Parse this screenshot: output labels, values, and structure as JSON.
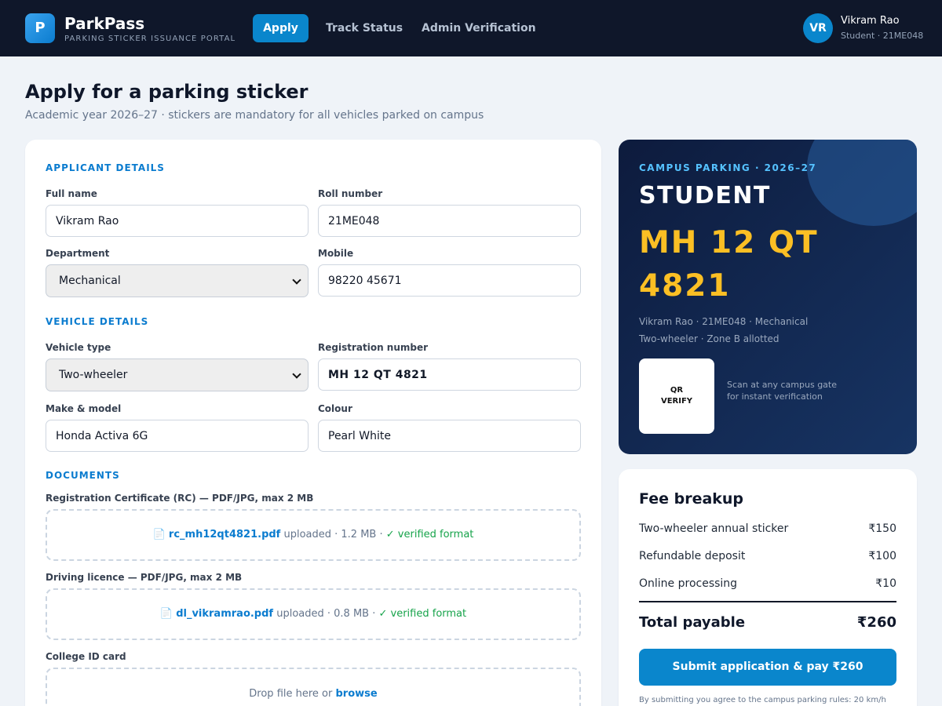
{
  "header": {
    "logo_letter": "P",
    "brand": "ParkPass",
    "brand_sub": "PARKING STICKER ISSUANCE PORTAL",
    "nav": [
      "Apply",
      "Track Status",
      "Admin Verification"
    ],
    "user": {
      "initials": "VR",
      "name": "Vikram Rao",
      "sub": "Student · 21ME048"
    }
  },
  "page": {
    "title": "Apply for a parking sticker",
    "subtitle": "Academic year 2026–27 · stickers are mandatory for all vehicles parked on campus"
  },
  "form": {
    "applicant_title": "APPLICANT DETAILS",
    "full_name_label": "Full name",
    "full_name": "Vikram Rao",
    "roll_label": "Roll number",
    "roll": "21ME048",
    "dept_label": "Department",
    "dept": "Mechanical",
    "mobile_label": "Mobile",
    "mobile": "98220 45671",
    "vehicle_title": "VEHICLE DETAILS",
    "vehicle_type_label": "Vehicle type",
    "vehicle_type": "Two-wheeler",
    "reg_label": "Registration number",
    "reg": "MH 12 QT 4821",
    "make_label": "Make & model",
    "make": "Honda Activa 6G",
    "colour_label": "Colour",
    "colour": "Pearl White",
    "documents_title": "DOCUMENTS",
    "rc_label": "Registration Certificate (RC) — PDF/JPG, max 2 MB",
    "rc_file": "rc_mh12qt4821.pdf",
    "rc_meta": "uploaded · 1.2 MB ·",
    "rc_status": "✓ verified format",
    "dl_label": "Driving licence — PDF/JPG, max 2 MB",
    "dl_file": "dl_vikramrao.pdf",
    "dl_meta": "uploaded · 0.8 MB ·",
    "dl_status": "✓ verified format",
    "id_label": "College ID card",
    "id_drop": "Drop file here or",
    "id_browse": "browse"
  },
  "sticker": {
    "kicker": "CAMPUS PARKING · 2026–27",
    "role": "STUDENT",
    "plate": "MH 12 QT 4821",
    "info1": "Vikram Rao · 21ME048 · Mechanical",
    "info2": "Two-wheeler · Zone B allotted",
    "qr_line1": "QR",
    "qr_line2": "VERIFY",
    "qr_note1": "Scan at any campus gate",
    "qr_note2": "for instant verification"
  },
  "fees": {
    "title": "Fee breakup",
    "rows": [
      {
        "label": "Two-wheeler annual sticker",
        "amount": "₹150"
      },
      {
        "label": "Refundable deposit",
        "amount": "₹100"
      },
      {
        "label": "Online processing",
        "amount": "₹10"
      }
    ],
    "total_label": "Total payable",
    "total_amount": "₹260",
    "submit_label": "Submit application & pay ₹260",
    "fine_print": "By submitting you agree to the campus parking rules: 20 km/h"
  },
  "colors": {
    "accent": "#0a86cc",
    "header_bg": "#0f172a",
    "plate": "#fbbf24",
    "ok": "#16a34a"
  }
}
